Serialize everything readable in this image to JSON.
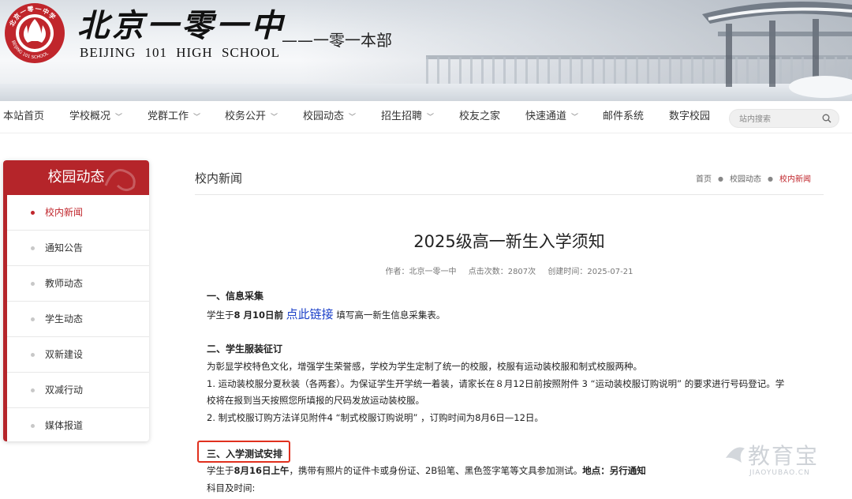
{
  "header": {
    "logo_ring_text": "北京一零一中学",
    "logo_bottom_text": "BEIJING 101 SCHOOL",
    "school_name_cn": "北京一零一中",
    "school_name_en": "BEIJING 101 HIGH SCHOOL",
    "campus": "——一零一本部"
  },
  "nav": {
    "items": [
      {
        "label": "本站首页",
        "dropdown": false
      },
      {
        "label": "学校概况",
        "dropdown": true
      },
      {
        "label": "党群工作",
        "dropdown": true
      },
      {
        "label": "校务公开",
        "dropdown": true
      },
      {
        "label": "校园动态",
        "dropdown": true
      },
      {
        "label": "招生招聘",
        "dropdown": true
      },
      {
        "label": "校友之家",
        "dropdown": false
      },
      {
        "label": "快速通道",
        "dropdown": true
      },
      {
        "label": "邮件系统",
        "dropdown": false
      },
      {
        "label": "数字校园",
        "dropdown": false
      }
    ],
    "search_placeholder": "站内搜索"
  },
  "sidebar": {
    "title": "校园动态",
    "items": [
      {
        "label": "校内新闻",
        "active": true
      },
      {
        "label": "通知公告",
        "active": false
      },
      {
        "label": "教师动态",
        "active": false
      },
      {
        "label": "学生动态",
        "active": false
      },
      {
        "label": "双新建设",
        "active": false
      },
      {
        "label": "双减行动",
        "active": false
      },
      {
        "label": "媒体报道",
        "active": false
      }
    ]
  },
  "content": {
    "section_title": "校内新闻",
    "breadcrumb": [
      "首页",
      "校园动态",
      "校内新闻"
    ],
    "article_title": "2025级高一新生入学须知",
    "meta": {
      "author": "作者：北京一零一中",
      "views": "点击次数：2807次",
      "created": "创建时间：2025-07-21"
    },
    "s1_heading": "一、信息采集",
    "s1_text_a": "学生于",
    "s1_date": "8 月10日前",
    "s1_link": "点此链接",
    "s1_text_b": "填写高一新生信息采集表。",
    "s2_heading": "二、学生服装征订",
    "s2_p1": "为彰显学校特色文化，增强学生荣誉感，学校为学生定制了统一的校服，校服有运动装校服和制式校服两种。",
    "s2_p2a": "1. 运动装校服分夏秋装（各两套）。为保证学生开学统一着装，请家长在８月12日前按照附件 3 “运动装校服订购说明” 的要求进行号码登记。学",
    "s2_p2b": "校将在报到当天按照您所填报的尺码发放运动装校服。",
    "s2_p3": "2. 制式校服订购方法详见附件4 “制式校服订购说明” ，订购时间为8月6日—12日。",
    "s3_heading": "三、入学测试安排",
    "s3_text_a": "学生于",
    "s3_date": "8月16日上午",
    "s3_text_b": "，携带有照片的证件卡或身份证、2B铅笔、黑色签字笔等文具参加测试。",
    "s3_place": "地点：另行通知",
    "s3_next": "科目及时间:"
  },
  "watermark": {
    "brand": "教育宝",
    "domain": "JIAOYUBAO.CN"
  },
  "colors": {
    "accent_red": "#b5252a",
    "link_blue": "#1a3fc8",
    "highlight_box": "#e0301e"
  }
}
